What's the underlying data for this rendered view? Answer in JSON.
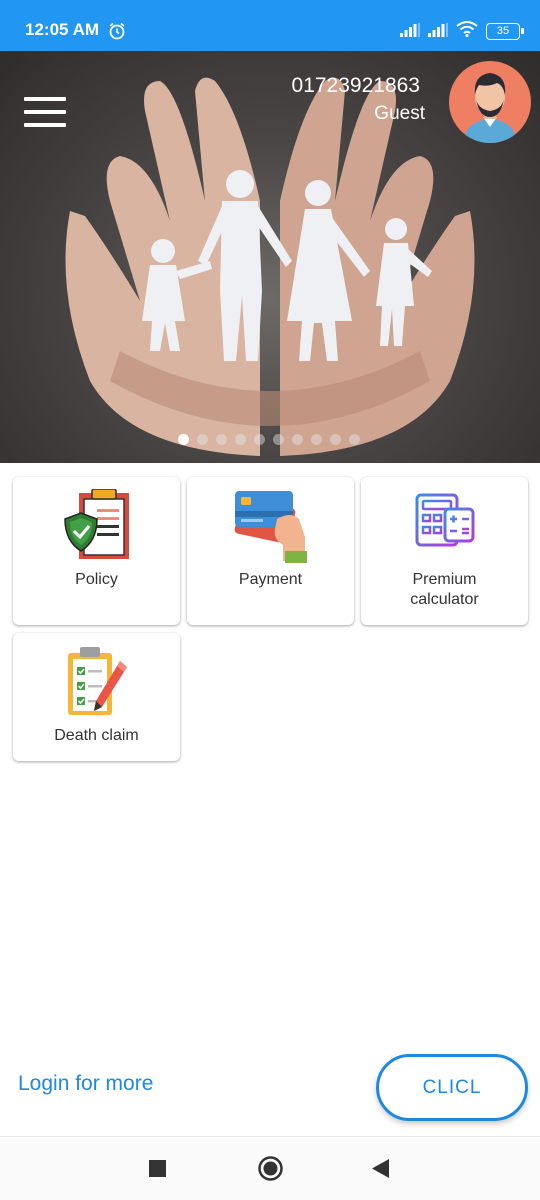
{
  "status_bar": {
    "time": "12:05 AM",
    "battery": "35",
    "icons": [
      "alarm-icon",
      "signal-icon",
      "signal-icon",
      "wifi-icon",
      "battery-icon"
    ]
  },
  "header": {
    "phone": "01723921863",
    "role": "Guest",
    "menu_icon": "hamburger-menu-icon",
    "avatar_icon": "user-avatar-icon"
  },
  "carousel": {
    "slide_count": 10,
    "active_index": 0
  },
  "menu": {
    "items": [
      {
        "label": "Policy",
        "icon": "policy-document-icon"
      },
      {
        "label": "Payment",
        "icon": "credit-card-payment-icon"
      },
      {
        "label": "Premium\ncalculator",
        "icon": "calculator-icon"
      },
      {
        "label": "Death claim",
        "icon": "clipboard-checklist-icon"
      }
    ]
  },
  "footer": {
    "login_link": "Login for more",
    "cta_button": "CLICL"
  },
  "nav": {
    "icons": [
      "recents-square-icon",
      "home-circle-icon",
      "back-triangle-icon"
    ]
  },
  "colors": {
    "primary": "#2196f3",
    "link": "#1e88e5",
    "avatar_bg": "#ef7f63"
  }
}
